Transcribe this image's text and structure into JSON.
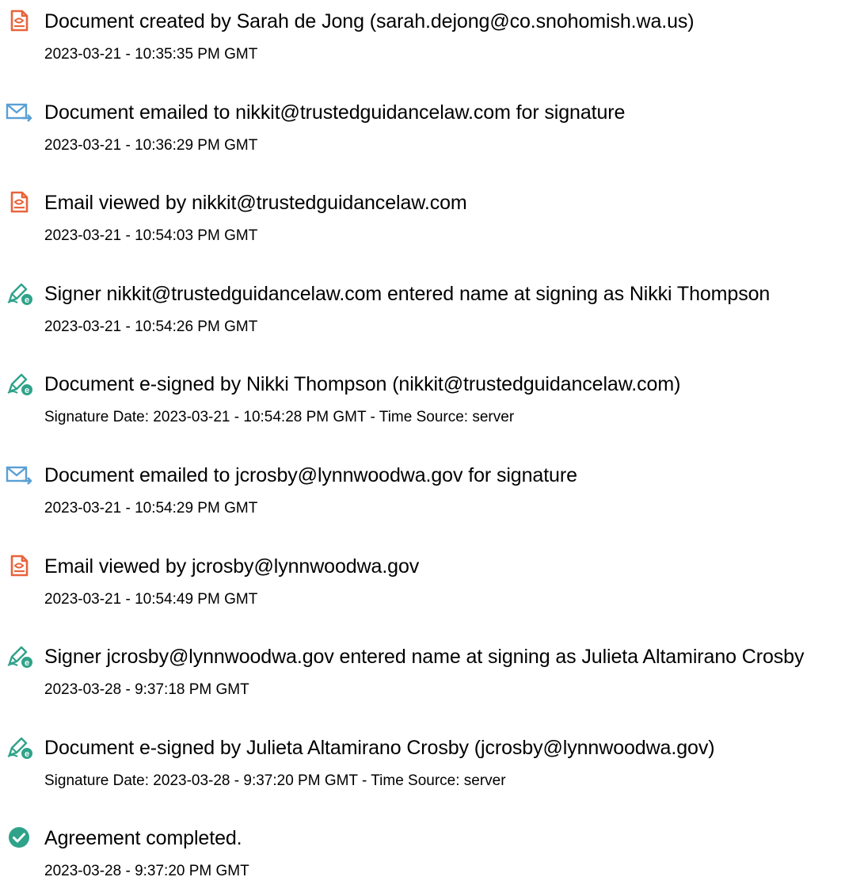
{
  "colors": {
    "doc_icon": "#e8643c",
    "mail_icon": "#5a9fd4",
    "sign_icon": "#2ea38a",
    "check_icon": "#2ea38a"
  },
  "events": [
    {
      "icon": "document-icon",
      "title": "Document created by Sarah de Jong (sarah.dejong@co.snohomish.wa.us)",
      "timestamp": "2023-03-21 - 10:35:35 PM GMT"
    },
    {
      "icon": "email-sent-icon",
      "title": "Document emailed to nikkit@trustedguidancelaw.com for signature",
      "timestamp": "2023-03-21 - 10:36:29 PM GMT"
    },
    {
      "icon": "document-icon",
      "title": "Email viewed by nikkit@trustedguidancelaw.com",
      "timestamp": "2023-03-21 - 10:54:03 PM GMT"
    },
    {
      "icon": "esign-pen-icon",
      "title": "Signer nikkit@trustedguidancelaw.com entered name at signing as Nikki Thompson",
      "timestamp": "2023-03-21 - 10:54:26 PM GMT"
    },
    {
      "icon": "esign-pen-icon",
      "title": "Document e-signed by Nikki Thompson (nikkit@trustedguidancelaw.com)",
      "timestamp": "Signature Date: 2023-03-21 - 10:54:28 PM GMT - Time Source: server"
    },
    {
      "icon": "email-sent-icon",
      "title": "Document emailed to jcrosby@lynnwoodwa.gov for signature",
      "timestamp": "2023-03-21 - 10:54:29 PM GMT"
    },
    {
      "icon": "document-icon",
      "title": "Email viewed by jcrosby@lynnwoodwa.gov",
      "timestamp": "2023-03-21 - 10:54:49 PM GMT"
    },
    {
      "icon": "esign-pen-icon",
      "title": "Signer jcrosby@lynnwoodwa.gov entered name at signing as Julieta Altamirano Crosby",
      "timestamp": "2023-03-28 - 9:37:18 PM GMT"
    },
    {
      "icon": "esign-pen-icon",
      "title": "Document e-signed by Julieta Altamirano Crosby (jcrosby@lynnwoodwa.gov)",
      "timestamp": "Signature Date: 2023-03-28 - 9:37:20 PM GMT - Time Source: server"
    },
    {
      "icon": "check-circle-icon",
      "title": "Agreement completed.",
      "timestamp": "2023-03-28 - 9:37:20 PM GMT"
    }
  ]
}
